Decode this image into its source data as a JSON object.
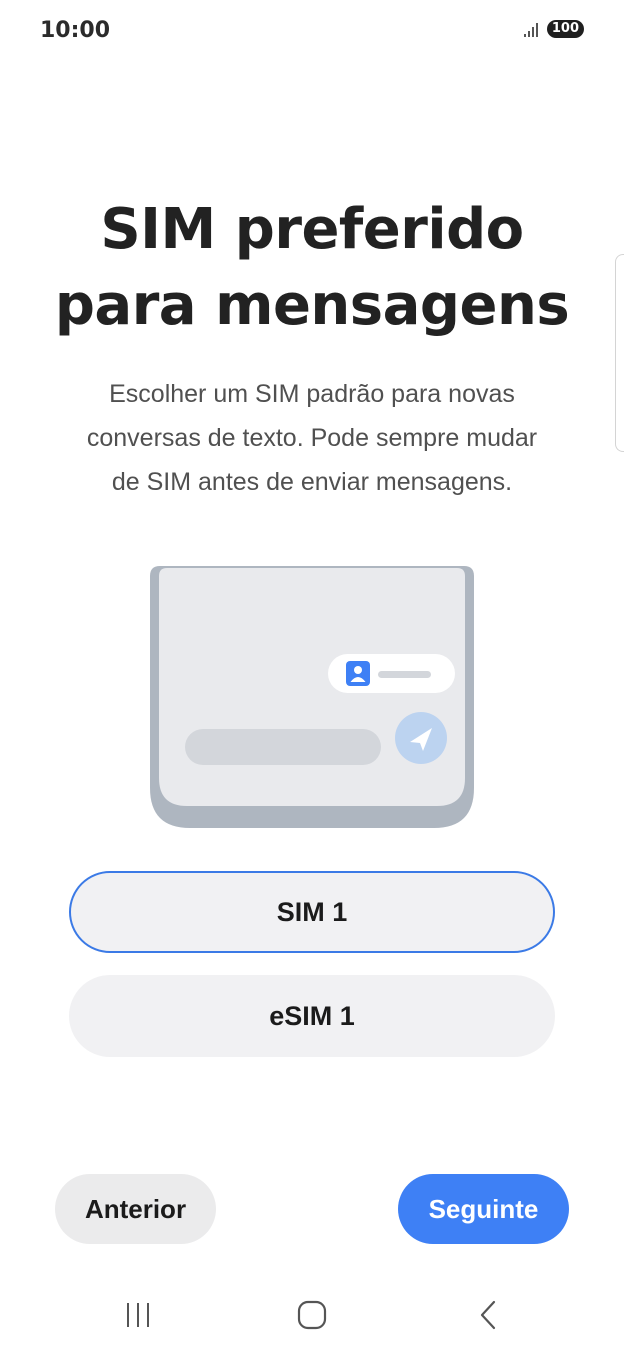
{
  "status_bar": {
    "time": "10:00",
    "battery": "100",
    "signal_icon": "signal-bars-icon"
  },
  "page": {
    "title_line1": "SIM preferido",
    "title_line2": "para mensagens",
    "subtitle": "Escolher um SIM padrão para novas conversas de texto. Pode sempre mudar de SIM antes de enviar mensagens."
  },
  "illustration": {
    "icons": [
      "contact-icon",
      "send-icon"
    ],
    "colors": {
      "screen": "#e9eaed",
      "frame": "#aeb6c0",
      "accent": "#3e80f5",
      "send_button": "#bcd3f0"
    }
  },
  "options": [
    {
      "label": "SIM 1",
      "selected": true
    },
    {
      "label": "eSIM 1",
      "selected": false
    }
  ],
  "buttons": {
    "previous": "Anterior",
    "next": "Seguinte"
  },
  "nav_bar": {
    "icons": [
      "recents-icon",
      "home-icon",
      "back-icon"
    ]
  },
  "colors": {
    "accent": "#3e80f5",
    "selected_border": "#3b7ae6",
    "option_bg": "#f1f1f3"
  }
}
